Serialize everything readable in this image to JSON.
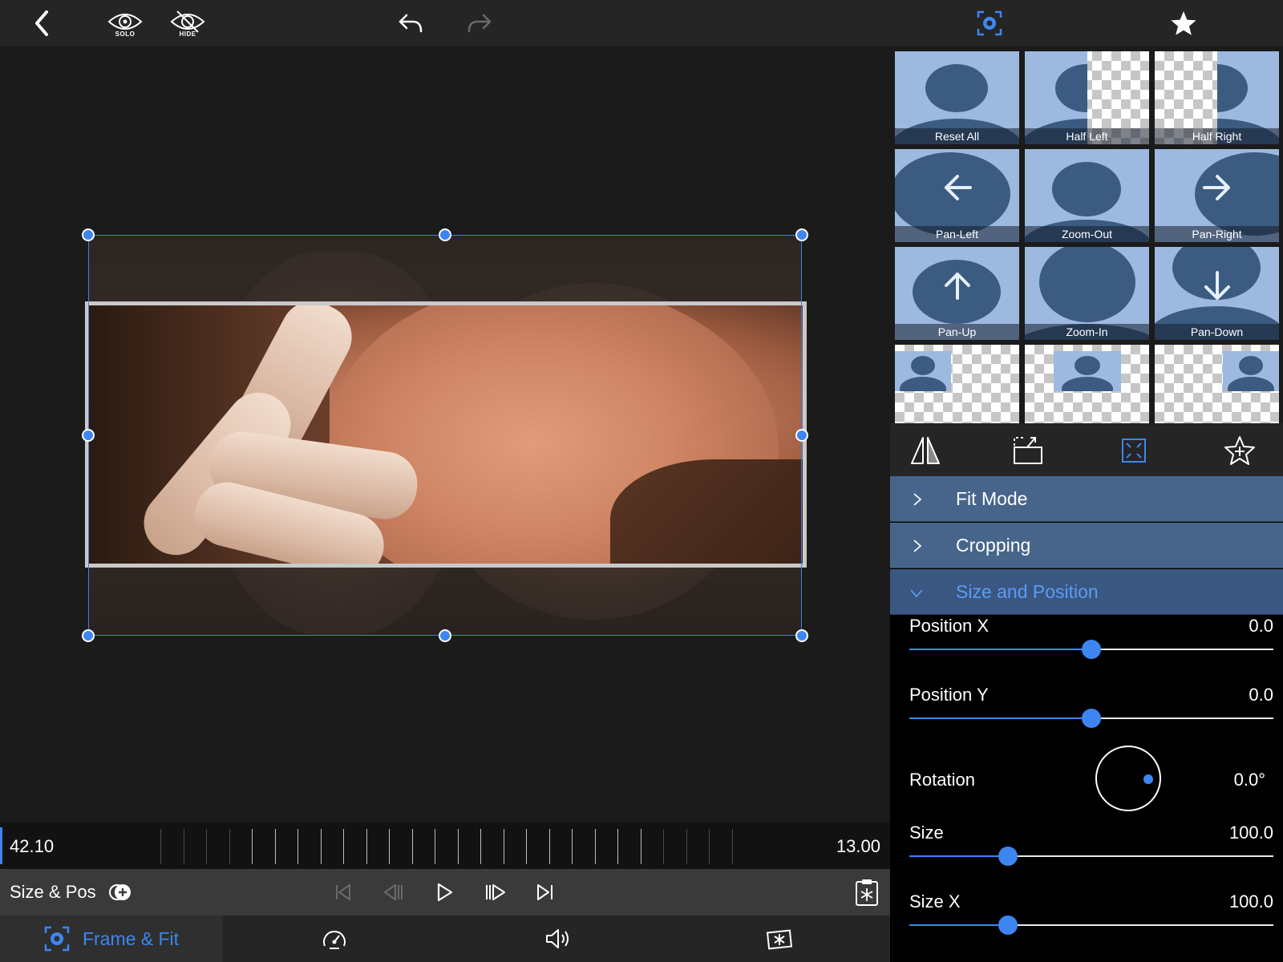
{
  "toolbar": {
    "back_icon": "chevron-left-icon",
    "solo_label": "SOLO",
    "hide_label": "HIDE",
    "undo_icon": "undo-icon",
    "redo_icon": "redo-icon",
    "frame_fit_icon": "frame-fit-icon",
    "favorites_icon": "star-icon"
  },
  "timeline": {
    "current_time": "42.10",
    "duration": "13.00"
  },
  "transport": {
    "mode_label": "Size & Pos",
    "keyframe_icon": "keyframe-add-icon",
    "controls": [
      "skip-to-start-icon",
      "step-back-icon",
      "play-icon",
      "step-forward-icon",
      "skip-to-end-icon"
    ],
    "snapshot_icon": "clipboard-snowflake-icon"
  },
  "bottom_tabs": {
    "active_label": "Frame & Fit",
    "items": [
      "frame-fit-icon",
      "speed-gauge-icon",
      "audio-icon",
      "effects-icon"
    ]
  },
  "presets": [
    {
      "label": "Reset All"
    },
    {
      "label": "Half Left"
    },
    {
      "label": "Half Right"
    },
    {
      "label": "Pan-Left"
    },
    {
      "label": "Zoom-Out"
    },
    {
      "label": "Pan-Right"
    },
    {
      "label": "Pan-Up"
    },
    {
      "label": "Zoom-In"
    },
    {
      "label": "Pan-Down"
    }
  ],
  "panel_tools": [
    "flip-icon",
    "crop-rotate-icon",
    "fit-frame-icon",
    "favorite-add-icon"
  ],
  "sections": {
    "fit_mode": "Fit Mode",
    "cropping": "Cropping",
    "size_position": "Size and Position"
  },
  "params": {
    "position_x": {
      "label": "Position X",
      "value": "0.0",
      "level": 0.5
    },
    "position_y": {
      "label": "Position Y",
      "value": "0.0",
      "level": 0.5
    },
    "rotation": {
      "label": "Rotation",
      "value": "0.0°"
    },
    "size": {
      "label": "Size",
      "value": "100.0",
      "level": 0.27
    },
    "size_x": {
      "label": "Size X",
      "value": "100.0",
      "level": 0.27
    }
  },
  "colors": {
    "accent": "#3d86f2",
    "section_bg": "#47658a",
    "preset_bg": "#9db9e0",
    "silhouette": "#3b5b80"
  }
}
